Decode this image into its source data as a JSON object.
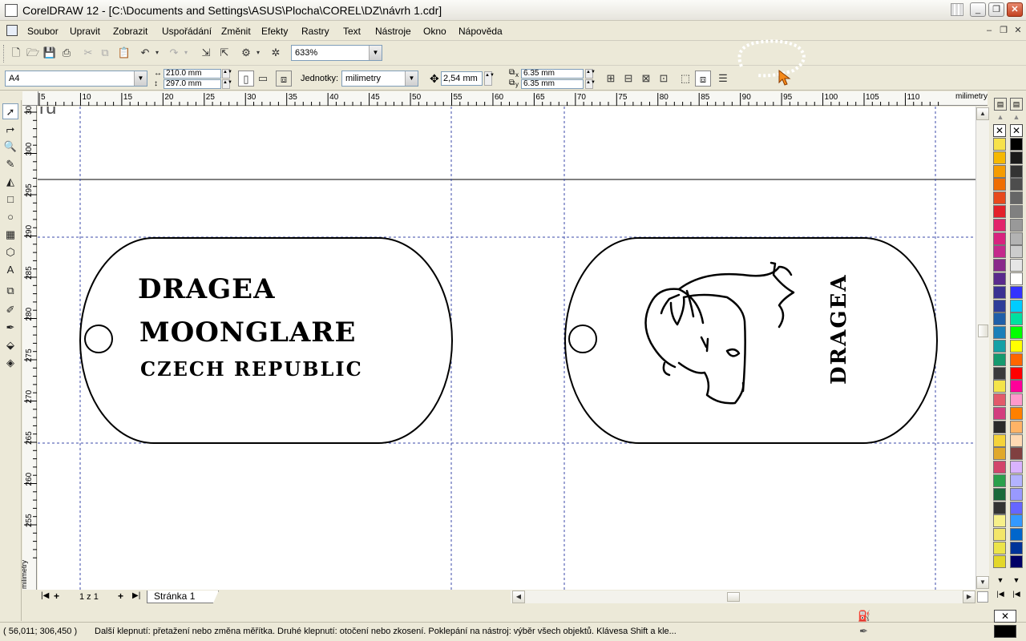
{
  "window": {
    "title": "CorelDRAW 12 - [C:\\Documents and Settings\\ASUS\\Plocha\\COREL\\DZ\\návrh 1.cdr]",
    "minimize_label": "_",
    "maximize_label": "❐",
    "close_label": "✕"
  },
  "menu": {
    "items": [
      "Soubor",
      "Upravit",
      "Zobrazit",
      "Uspořádání",
      "Změnit",
      "Efekty",
      "Rastry",
      "Text",
      "Nástroje",
      "Okno",
      "Nápověda"
    ]
  },
  "toolbar": {
    "zoom": "633%"
  },
  "property_bar": {
    "page_size": "A4",
    "width": "210.0 mm",
    "height": "297.0 mm",
    "units_label": "Jednotky:",
    "units_value": "milimetry",
    "nudge": "2,54 mm",
    "dup_x_label": "x",
    "dup_x": "6.35 mm",
    "dup_y_label": "y",
    "dup_y": "6.35 mm"
  },
  "rulers": {
    "h_ticks": [
      "5",
      "10",
      "15",
      "20",
      "25",
      "30",
      "35",
      "40",
      "45",
      "50",
      "55",
      "60",
      "65",
      "70",
      "75",
      "80",
      "85",
      "90",
      "95",
      "100",
      "105",
      "110"
    ],
    "h_unit": "milimetry",
    "v_ticks": [
      "305",
      "300",
      "295",
      "290",
      "285",
      "280",
      "275",
      "270",
      "265",
      "260",
      "255"
    ],
    "v_unit": "milimetry"
  },
  "canvas": {
    "corner_text": "ru",
    "tag_left": {
      "line1": "DRAGEA",
      "line2": "MOONGLARE",
      "line3": "CZECH REPUBLIC"
    },
    "tag_right": {
      "vertical_text": "DRAGEA"
    }
  },
  "pages": {
    "counter": "1 z 1",
    "tab_label": "Stránka 1",
    "add_label": "+"
  },
  "status": {
    "coords": "( 56,011; 306,450 )",
    "message": "Další klepnutí: přetažení nebo změna měřítka. Druhé klepnutí: otočení  nebo zkosení. Poklepání na nástroj: výběr všech objektů. Klávesa Shift a kle..."
  },
  "palette": {
    "left_column": [
      "#f7e24a",
      "#f5b800",
      "#f59c00",
      "#ef6e00",
      "#e84a1c",
      "#e3212a",
      "#e2246a",
      "#d8237e",
      "#c42a8b",
      "#8a2a8a",
      "#5a2a8c",
      "#3a3192",
      "#2e3d98",
      "#1f5fa8",
      "#1a7fb8",
      "#15a0a5",
      "#169a6e",
      "#3a3a3a",
      "#f4e44a",
      "#e25a6a",
      "#d33d7e",
      "#2a2a2a",
      "#f5d33a",
      "#e0a82a",
      "#d2456a",
      "#2aa04a",
      "#1a6a3a",
      "#333333",
      "#f7f08a",
      "#f3e66a",
      "#ece44a",
      "#e3d72a",
      "#4a4acc",
      "#2a2a8a",
      "#1a1a6a",
      "#3a6ab0",
      "#5a9ad0",
      "#c9b24a",
      "#b09a2a",
      "#8a7a2a",
      "#d4d08a",
      "#c2be6a",
      "#a89f3a",
      "#ffffff"
    ],
    "right_column": [
      "#000000",
      "#1a1a1a",
      "#333333",
      "#4d4d4d",
      "#666666",
      "#808080",
      "#999999",
      "#b3b3b3",
      "#cccccc",
      "#e6e6e6",
      "#ffffff",
      "#3333ff",
      "#00ccff",
      "#00e0a0",
      "#00ff00",
      "#ffff00",
      "#ff6600",
      "#ff0000",
      "#ff0099",
      "#ff99cc",
      "#ff8000",
      "#ffb366",
      "#ffd9b3",
      "#804040",
      "#d9b3ff",
      "#b3b3ff",
      "#9999ff",
      "#6666ff",
      "#3399ff",
      "#0066cc",
      "#003399",
      "#000066",
      "#4a8ac4",
      "#66ccff",
      "#99ffff",
      "#ccffff",
      "#aaddcc",
      "#88ccbb"
    ]
  }
}
